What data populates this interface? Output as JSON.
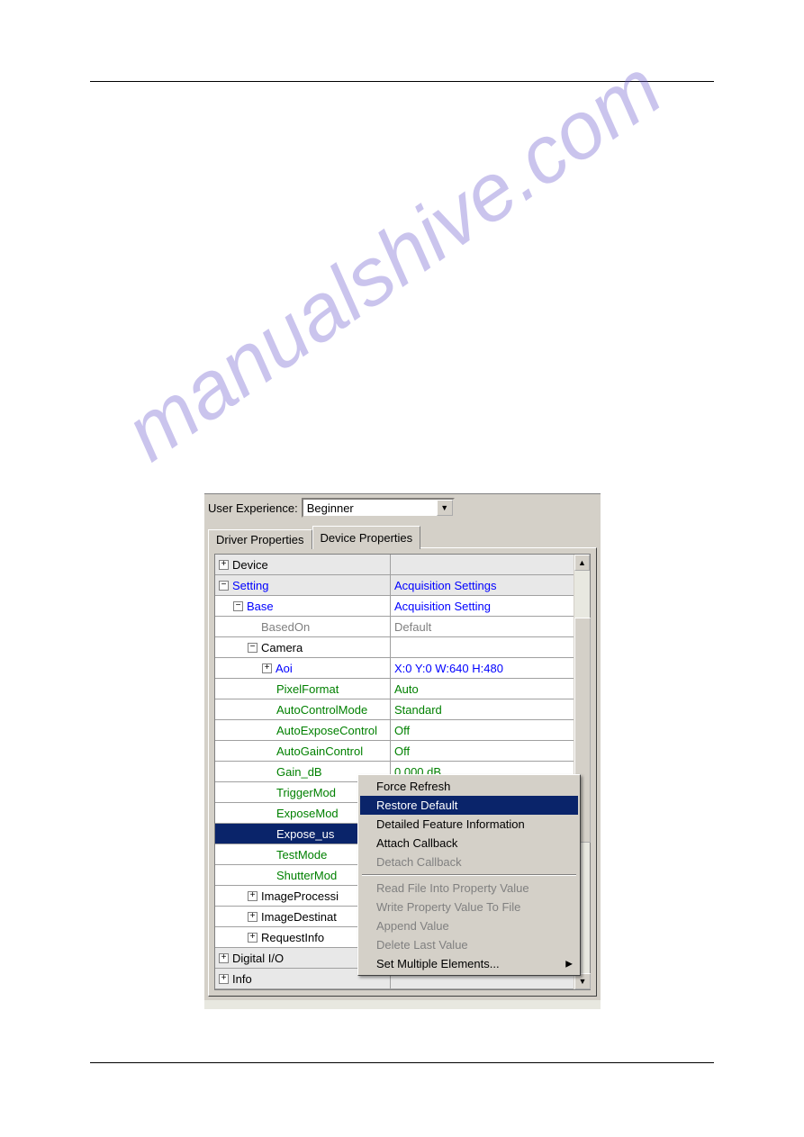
{
  "watermark": "manualshive.com",
  "ux_label": "User Experience:",
  "ux_value": "Beginner",
  "tabs": {
    "driver": "Driver Properties",
    "device": "Device Properties"
  },
  "rows": {
    "device": "Device",
    "setting": "Setting",
    "setting_val": "Acquisition Settings",
    "base": "Base",
    "base_val": "Acquisition Setting",
    "basedon": "BasedOn",
    "basedon_val": "Default",
    "camera": "Camera",
    "aoi": "Aoi",
    "aoi_val": "X:0 Y:0 W:640 H:480",
    "pixel": "PixelFormat",
    "pixel_val": "Auto",
    "acm": "AutoControlMode",
    "acm_val": "Standard",
    "aec": "AutoExposeControl",
    "aec_val": "Off",
    "agc": "AutoGainControl",
    "agc_val": "Off",
    "gain": "Gain_dB",
    "gain_val": "0.000 dB",
    "trigger": "TriggerMod",
    "exposemod": "ExposeMod",
    "exposeus": "Expose_us",
    "testmode": "TestMode",
    "shutter": "ShutterMod",
    "imgproc": "ImageProcessi",
    "imgdest": "ImageDestinat",
    "reqinfo": "RequestInfo",
    "digitalio": "Digital I/O",
    "info": "Info"
  },
  "menu": {
    "force_refresh": "Force Refresh",
    "restore_default": "Restore Default",
    "detailed_info": "Detailed Feature Information",
    "attach_cb": "Attach Callback",
    "detach_cb": "Detach Callback",
    "read_file": "Read File Into Property Value",
    "write_file": "Write Property Value To File",
    "append_val": "Append Value",
    "delete_last": "Delete Last Value",
    "set_multiple": "Set Multiple Elements..."
  }
}
